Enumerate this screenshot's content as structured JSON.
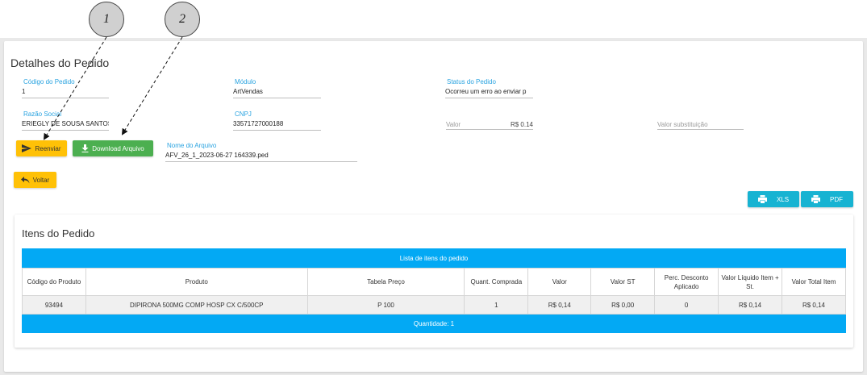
{
  "page": {
    "title": "Detalhes do Pedido"
  },
  "fields": {
    "codigo_pedido": {
      "label": "Código do Pedido",
      "value": "1"
    },
    "modulo": {
      "label": "Módulo",
      "value": "ArtVendas"
    },
    "status_pedido": {
      "label": "Status do Pedido",
      "value": "Ocorreu um erro ao enviar p"
    },
    "razao_social": {
      "label": "Razão Social",
      "value": "ERIEGLY DE SOUSA SANTOS"
    },
    "cnpj": {
      "label": "CNPJ",
      "value": "33571727000188"
    },
    "valor": {
      "label": "Valor",
      "value": "R$ 0.14"
    },
    "valor_substituicao": {
      "label": "Valor substituição",
      "value": ""
    },
    "nome_arquivo": {
      "label": "Nome do Arquivo",
      "value": "AFV_26_1_2023-06-27 164339.ped"
    }
  },
  "buttons": {
    "reenviar": "Reenviar",
    "download": "Download Arquivo",
    "voltar": "Voltar",
    "xls": "XLS",
    "pdf": "PDF"
  },
  "annotations": {
    "one": "1",
    "two": "2"
  },
  "items": {
    "title": "Itens do Pedido",
    "table_caption": "Lista de itens do pedido",
    "columns": [
      "Código do Produto",
      "Produto",
      "Tabela Preço",
      "Quant. Comprada",
      "Valor",
      "Valor ST",
      "Perc. Desconto Aplicado",
      "Valor Líquido Item + St.",
      "Valor Total Item"
    ],
    "rows": [
      [
        "93494",
        "DIPIRONA 500MG COMP HOSP CX C/500CP",
        "P 100",
        "1",
        "R$ 0,14",
        "R$ 0,00",
        "0",
        "R$ 0,14",
        "R$ 0,14"
      ]
    ],
    "footer": "Quantidade: 1"
  },
  "colors": {
    "primary": "#03a9f4",
    "warning": "#ffc107",
    "success": "#4caf50",
    "label": "#29a3e0"
  }
}
